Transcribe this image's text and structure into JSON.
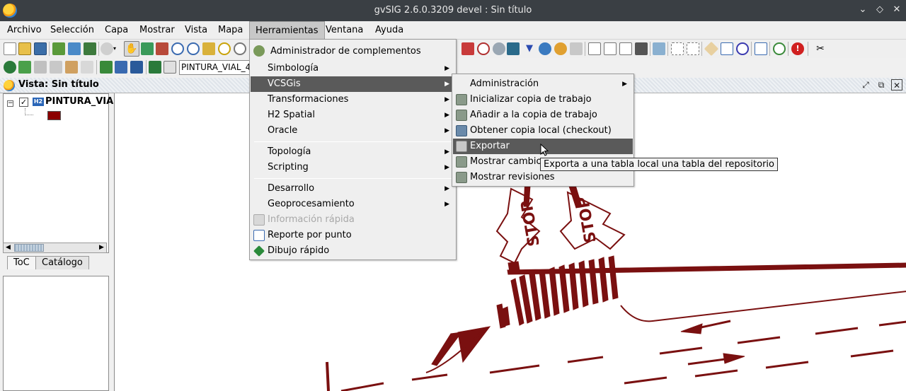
{
  "window": {
    "title": "gvSIG 2.6.0.3209 devel : Sin título",
    "controls": [
      "chevron-down-icon",
      "diamond-icon",
      "close-icon"
    ]
  },
  "menubar": {
    "items": [
      {
        "label": "Archivo"
      },
      {
        "label": "Selección"
      },
      {
        "label": "Capa"
      },
      {
        "label": "Mostrar"
      },
      {
        "label": "Vista"
      },
      {
        "label": "Mapa"
      },
      {
        "label": "Herramientas"
      },
      {
        "label": "Ventana"
      },
      {
        "label": "Ayuda"
      }
    ]
  },
  "toolbar": {
    "layer_combo_value": "PINTURA_VIAL_4"
  },
  "view": {
    "title": "Vista: Sin título"
  },
  "toc": {
    "layer_name": "PINTURA_VIAL",
    "layer_type_badge": "H2",
    "checked": true,
    "symbol_color": "#8b0000",
    "tabs": [
      "ToC",
      "Catálogo"
    ]
  },
  "herramientas_menu": {
    "items": [
      {
        "label": "Administrador de complementos",
        "icon": "gear-icon"
      },
      {
        "label": "Simbología",
        "submenu": true
      },
      {
        "label": "VCSGis",
        "submenu": true,
        "selected": true
      },
      {
        "label": "Transformaciones",
        "submenu": true
      },
      {
        "label": "H2 Spatial",
        "submenu": true
      },
      {
        "label": "Oracle",
        "submenu": true
      },
      {
        "label": "Topología",
        "submenu": true
      },
      {
        "label": "Scripting",
        "submenu": true
      },
      {
        "label": "Desarrollo",
        "submenu": true
      },
      {
        "label": "Geoprocesamiento",
        "submenu": true
      },
      {
        "label": "Información rápida",
        "disabled": true,
        "icon": "info-icon"
      },
      {
        "label": "Reporte por punto",
        "icon": "report-icon"
      },
      {
        "label": "Dibujo rápido",
        "icon": "pencil-icon"
      }
    ]
  },
  "vcsgis_menu": {
    "items": [
      {
        "label": "Administración",
        "submenu": true
      },
      {
        "label": "Inicializar copia de trabajo",
        "icon": "database-icon"
      },
      {
        "label": "Añadir a la copia de trabajo",
        "icon": "database-add-icon"
      },
      {
        "label": "Obtener copia local (checkout)",
        "icon": "database-download-icon"
      },
      {
        "label": "Exportar",
        "icon": "export-icon",
        "selected": true
      },
      {
        "label": "Mostrar cambios",
        "icon": "changes-icon"
      },
      {
        "label": "Mostrar revisiones",
        "icon": "revisions-icon"
      }
    ]
  },
  "tooltip": {
    "text": "Exporta a una tabla local una tabla del repositorio"
  },
  "map": {
    "stop_text": "STOP",
    "paint_color": "#7a1010"
  }
}
